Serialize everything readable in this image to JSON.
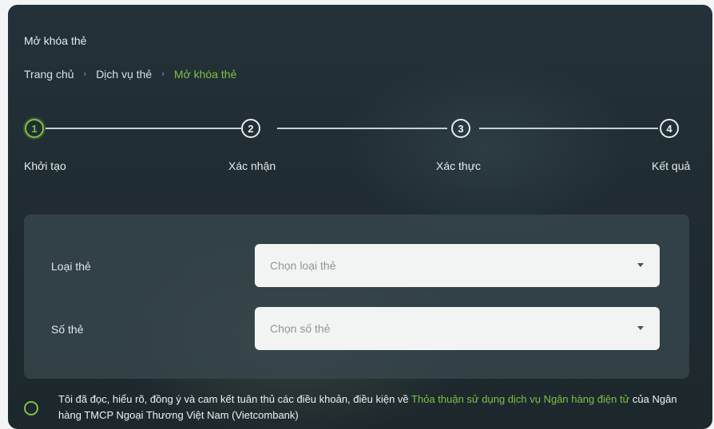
{
  "page": {
    "title": "Mở khóa thẻ"
  },
  "breadcrumb": [
    {
      "label": "Trang chủ"
    },
    {
      "label": "Dịch vụ thẻ"
    },
    {
      "label": "Mở khóa thẻ"
    }
  ],
  "breadcrumb_separator": "›",
  "steps": [
    {
      "number": "1",
      "label": "Khởi tạo",
      "active": true
    },
    {
      "number": "2",
      "label": "Xác nhận",
      "active": false
    },
    {
      "number": "3",
      "label": "Xác thực",
      "active": false
    },
    {
      "number": "4",
      "label": "Kết quả",
      "active": false
    }
  ],
  "form": {
    "card_type": {
      "label": "Loại thẻ",
      "placeholder": "Chọn loại thẻ"
    },
    "card_number": {
      "label": "Số thẻ",
      "placeholder": "Chọn số thẻ"
    }
  },
  "agreement": {
    "text_before": "Tôi đã đọc, hiểu rõ, đồng ý và cam kết tuân thủ các điều khoản, điều kiện về ",
    "link_text": "Thỏa thuận sử dụng dịch vụ Ngân hàng điện tử",
    "text_after": " của Ngân hàng TMCP Ngoại Thương Việt Nam (Vietcombank)"
  },
  "colors": {
    "accent": "#7dc242",
    "background": "#1f2b31",
    "panel": "#3a4950",
    "input": "#f2f3f3"
  }
}
